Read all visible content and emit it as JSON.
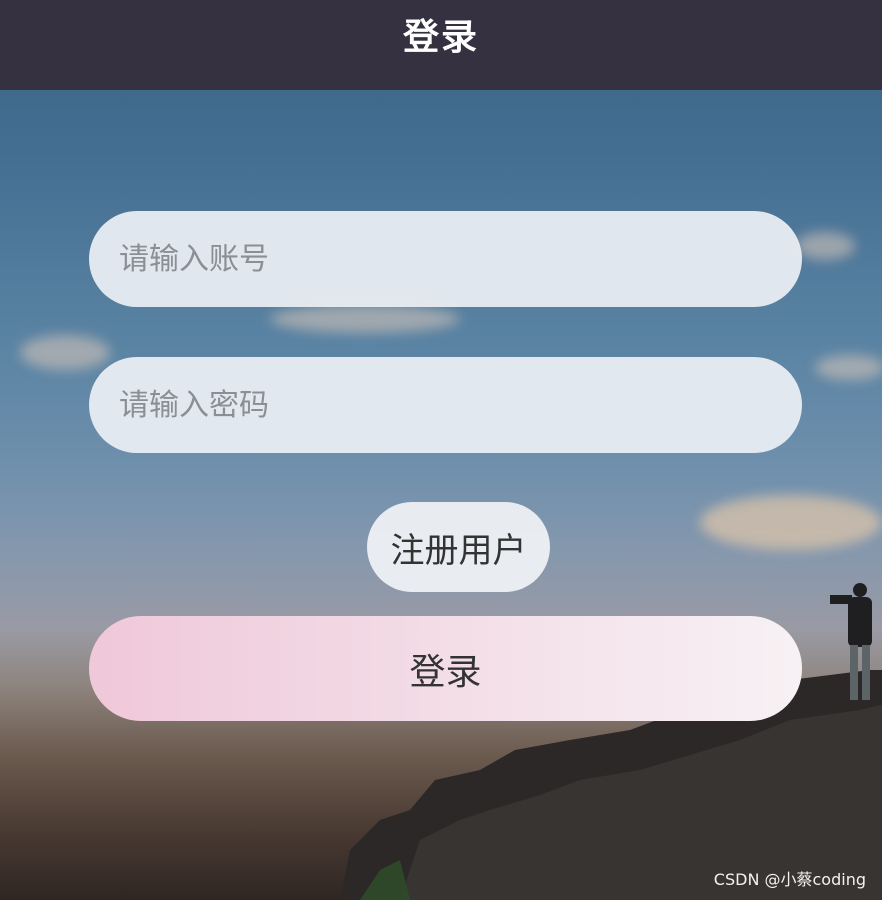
{
  "header": {
    "title": "登录"
  },
  "form": {
    "account_placeholder": "请输入账号",
    "password_placeholder": "请输入密码",
    "register_label": "注册用户",
    "login_label": "登录"
  },
  "watermark": "CSDN @小蔡coding",
  "colors": {
    "header_bg": "#353140",
    "field_bg": "#e9edf2",
    "login_gradient_start": "#efc8d9",
    "login_gradient_end": "#f7f1f4"
  }
}
